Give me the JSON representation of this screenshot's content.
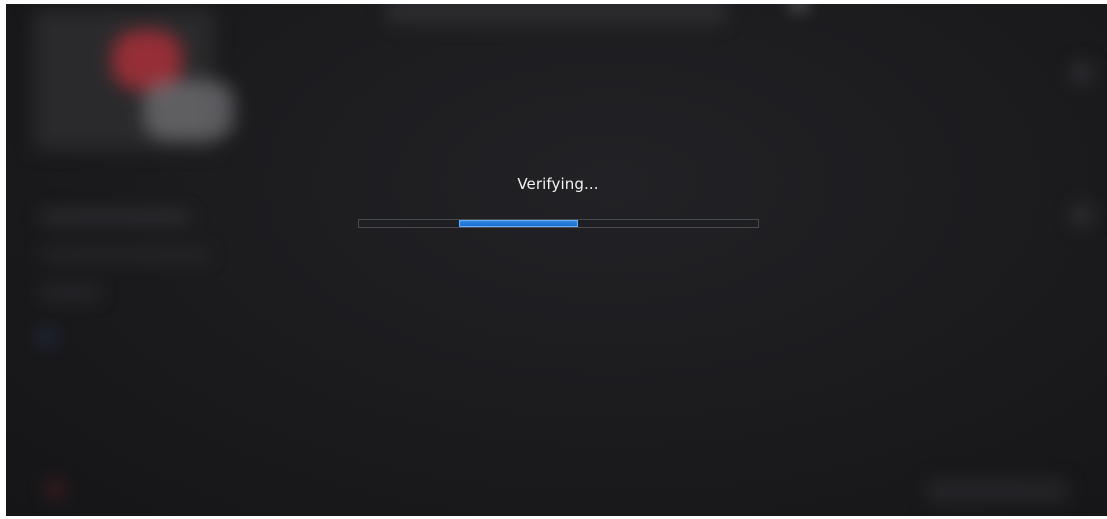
{
  "dialog": {
    "status_text": "Verifying...",
    "progress": {
      "mode": "indeterminate",
      "indicator_start_fraction": 0.25,
      "indicator_length_fraction": 0.3,
      "track_color": "#1e1f22",
      "fill_color": "#1d6fd0",
      "fill_border_color": "#69b1ff"
    }
  },
  "theme": {
    "background": "#1c1c1f",
    "text_color": "#f2f2f2",
    "accent_red": "#b0303a"
  }
}
